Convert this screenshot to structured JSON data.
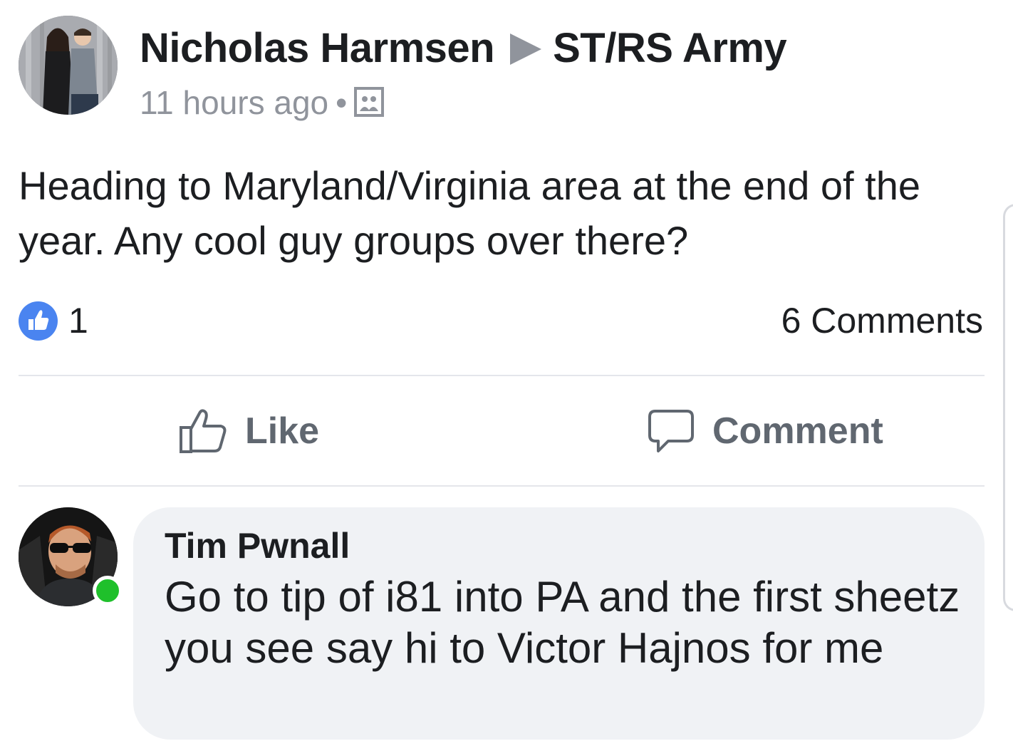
{
  "post": {
    "author": "Nicholas Harmsen",
    "group": "ST/RS Army",
    "timestamp": "11 hours ago",
    "separator": "•",
    "audience_icon": "group-icon",
    "text": "Heading to Maryland/Virginia area at the end of the year. Any cool guy groups over there?",
    "like_count": "1",
    "comments_count": "6 Comments"
  },
  "actions": {
    "like_label": "Like",
    "comment_label": "Comment"
  },
  "comment": {
    "author": "Tim Pwnall",
    "text": "Go to tip of i81 into PA and the first sheetz you see say hi to Victor Hajnos for me"
  },
  "colors": {
    "like_blue": "#4a84f0",
    "online_green": "#1fc02b",
    "muted_text": "#90949c",
    "action_text": "#606770",
    "bubble_bg": "#f0f2f5"
  }
}
